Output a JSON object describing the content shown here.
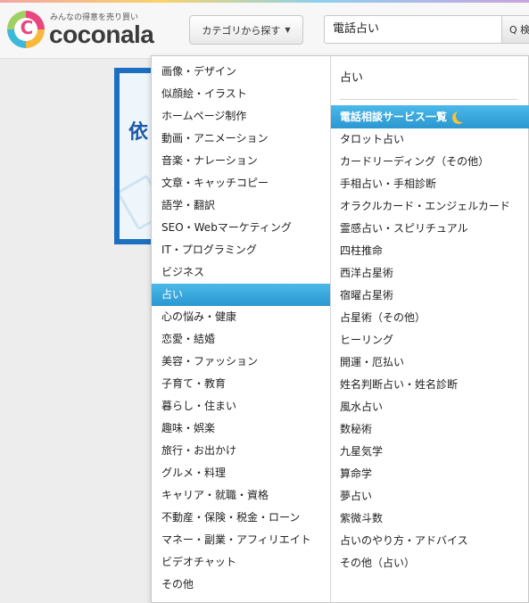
{
  "header": {
    "logo_tagline": "みんなの得意を売り買い",
    "logo_word": "coconala",
    "logo_mark_letter": "C",
    "category_button_label": "カテゴリから探す",
    "category_caret_icon": "chevron-down-icon",
    "search_value": "電話占い",
    "search_button_label": "Q 検",
    "search_icon": "search-icon"
  },
  "banner": {
    "text": "依"
  },
  "menu": {
    "categories": [
      "画像・デザイン",
      "似顔絵・イラスト",
      "ホームページ制作",
      "動画・アニメーション",
      "音楽・ナレーション",
      "文章・キャッチコピー",
      "語学・翻訳",
      "SEO・Webマーケティング",
      "IT・プログラミング",
      "ビジネス",
      "占い",
      "心の悩み・健康",
      "恋愛・結婚",
      "美容・ファッション",
      "子育て・教育",
      "暮らし・住まい",
      "趣味・娯楽",
      "旅行・お出かけ",
      "グルメ・料理",
      "キャリア・就職・資格",
      "不動産・保険・税金・ローン",
      "マネー・副業・アフィリエイト",
      "ビデオチャット",
      "その他"
    ],
    "active_category": "占い",
    "subcategory_title": "占い",
    "highlight_sub": "電話相談サービス一覧",
    "highlight_icon": "moon-icon",
    "subcategories": [
      "タロット占い",
      "カードリーディング（その他）",
      "手相占い・手相診断",
      "オラクルカード・エンジェルカード",
      "霊感占い・スピリチュアル",
      "四柱推命",
      "西洋占星術",
      "宿曜占星術",
      "占星術（その他）",
      "ヒーリング",
      "開運・厄払い",
      "姓名判断占い・姓名診断",
      "風水占い",
      "数秘術",
      "九星気学",
      "算命学",
      "夢占い",
      "紫微斗数",
      "占いのやり方・アドバイス",
      "その他（占い）"
    ]
  },
  "colors": {
    "accent_blue": "#2a97d1",
    "brand_pink": "#e9467f",
    "moon_yellow": "#f6c23b"
  }
}
